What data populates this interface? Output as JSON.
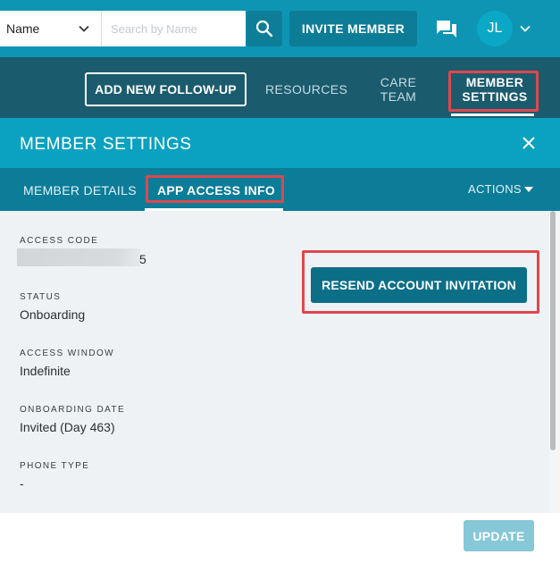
{
  "topbar": {
    "search_field_select": "Name",
    "search_placeholder": "Search by Name",
    "invite_label": "INVITE MEMBER",
    "avatar_initials": "JL"
  },
  "nav": {
    "add_follow_up": "ADD NEW FOLLOW-UP",
    "resources": "RESOURCES",
    "care_team_line1": "CARE",
    "care_team_line2": "TEAM",
    "member_settings_line1": "MEMBER",
    "member_settings_line2": "SETTINGS"
  },
  "panel": {
    "title": "MEMBER SETTINGS"
  },
  "tabs": {
    "member_details": "MEMBER DETAILS",
    "app_access_info": "APP ACCESS INFO",
    "actions": "ACTIONS"
  },
  "fields": {
    "access_code_label": "ACCESS CODE",
    "access_code_visible_tail": "5",
    "status_label": "STATUS",
    "status_value": "Onboarding",
    "access_window_label": "ACCESS WINDOW",
    "access_window_value": "Indefinite",
    "onboarding_date_label": "ONBOARDING DATE",
    "onboarding_date_value": "Invited (Day 463)",
    "phone_type_label": "PHONE TYPE",
    "phone_type_value": "-"
  },
  "buttons": {
    "resend_invitation": "RESEND ACCOUNT INVITATION",
    "update": "UPDATE"
  },
  "colors": {
    "topbar": "#0e95b4",
    "navbar": "#1b5b6e",
    "panel_header": "#0aa2c0",
    "tabs_bar": "#0b7d98",
    "highlight_box": "#e0474c",
    "primary_button": "#0c6f88",
    "disabled_button": "#86c7d8"
  }
}
